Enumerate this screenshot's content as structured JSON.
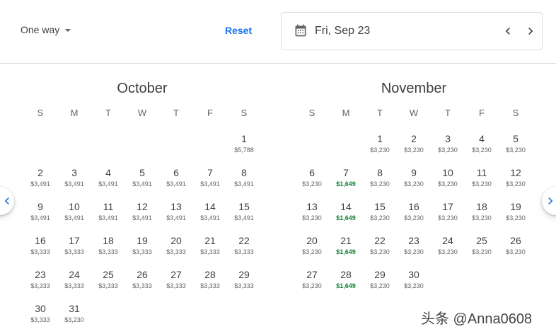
{
  "header": {
    "trip_type": "One way",
    "reset_label": "Reset",
    "departure_date": "Fri, Sep 23"
  },
  "calendar": {
    "weekdays": [
      "S",
      "M",
      "T",
      "W",
      "T",
      "F",
      "S"
    ],
    "months": [
      {
        "name": "October",
        "lead_blanks": 6,
        "days": [
          {
            "day": "1",
            "price": "$5,788"
          },
          {
            "day": "2",
            "price": "$3,491"
          },
          {
            "day": "3",
            "price": "$3,491"
          },
          {
            "day": "4",
            "price": "$3,491"
          },
          {
            "day": "5",
            "price": "$3,491"
          },
          {
            "day": "6",
            "price": "$3,491"
          },
          {
            "day": "7",
            "price": "$3,491"
          },
          {
            "day": "8",
            "price": "$3,491"
          },
          {
            "day": "9",
            "price": "$3,491"
          },
          {
            "day": "10",
            "price": "$3,491"
          },
          {
            "day": "11",
            "price": "$3,491"
          },
          {
            "day": "12",
            "price": "$3,491"
          },
          {
            "day": "13",
            "price": "$3,491"
          },
          {
            "day": "14",
            "price": "$3,491"
          },
          {
            "day": "15",
            "price": "$3,491"
          },
          {
            "day": "16",
            "price": "$3,333"
          },
          {
            "day": "17",
            "price": "$3,333"
          },
          {
            "day": "18",
            "price": "$3,333"
          },
          {
            "day": "19",
            "price": "$3,333"
          },
          {
            "day": "20",
            "price": "$3,333"
          },
          {
            "day": "21",
            "price": "$3,333"
          },
          {
            "day": "22",
            "price": "$3,333"
          },
          {
            "day": "23",
            "price": "$3,333"
          },
          {
            "day": "24",
            "price": "$3,333"
          },
          {
            "day": "25",
            "price": "$3,333"
          },
          {
            "day": "26",
            "price": "$3,333"
          },
          {
            "day": "27",
            "price": "$3,333"
          },
          {
            "day": "28",
            "price": "$3,333"
          },
          {
            "day": "29",
            "price": "$3,333"
          },
          {
            "day": "30",
            "price": "$3,333"
          },
          {
            "day": "31",
            "price": "$3,230"
          }
        ]
      },
      {
        "name": "November",
        "lead_blanks": 2,
        "days": [
          {
            "day": "1",
            "price": "$3,230"
          },
          {
            "day": "2",
            "price": "$3,230"
          },
          {
            "day": "3",
            "price": "$3,230"
          },
          {
            "day": "4",
            "price": "$3,230"
          },
          {
            "day": "5",
            "price": "$3,230"
          },
          {
            "day": "6",
            "price": "$3,230"
          },
          {
            "day": "7",
            "price": "$1,649",
            "low": true
          },
          {
            "day": "8",
            "price": "$3,230"
          },
          {
            "day": "9",
            "price": "$3,230"
          },
          {
            "day": "10",
            "price": "$3,230"
          },
          {
            "day": "11",
            "price": "$3,230"
          },
          {
            "day": "12",
            "price": "$3,230"
          },
          {
            "day": "13",
            "price": "$3,230"
          },
          {
            "day": "14",
            "price": "$1,649",
            "low": true
          },
          {
            "day": "15",
            "price": "$3,230"
          },
          {
            "day": "16",
            "price": "$3,230"
          },
          {
            "day": "17",
            "price": "$3,230"
          },
          {
            "day": "18",
            "price": "$3,230"
          },
          {
            "day": "19",
            "price": "$3,230"
          },
          {
            "day": "20",
            "price": "$3,230"
          },
          {
            "day": "21",
            "price": "$1,649",
            "low": true
          },
          {
            "day": "22",
            "price": "$3,230"
          },
          {
            "day": "23",
            "price": "$3,230"
          },
          {
            "day": "24",
            "price": "$3,230"
          },
          {
            "day": "25",
            "price": "$3,230"
          },
          {
            "day": "26",
            "price": "$3,230"
          },
          {
            "day": "27",
            "price": "$3,230"
          },
          {
            "day": "28",
            "price": "$1,649",
            "low": true
          },
          {
            "day": "29",
            "price": "$3,230"
          },
          {
            "day": "30",
            "price": "$3,230"
          }
        ]
      }
    ]
  },
  "watermark": "头条 @Anna0608",
  "colors": {
    "accent": "#1a73e8",
    "low_price": "#188038",
    "text": "#3c4043",
    "divider": "#dadce0"
  },
  "icons": {
    "date_field": "calendar-icon",
    "trip_dropdown": "chevron-down-icon",
    "prev": "chevron-left-icon",
    "next": "chevron-right-icon"
  }
}
